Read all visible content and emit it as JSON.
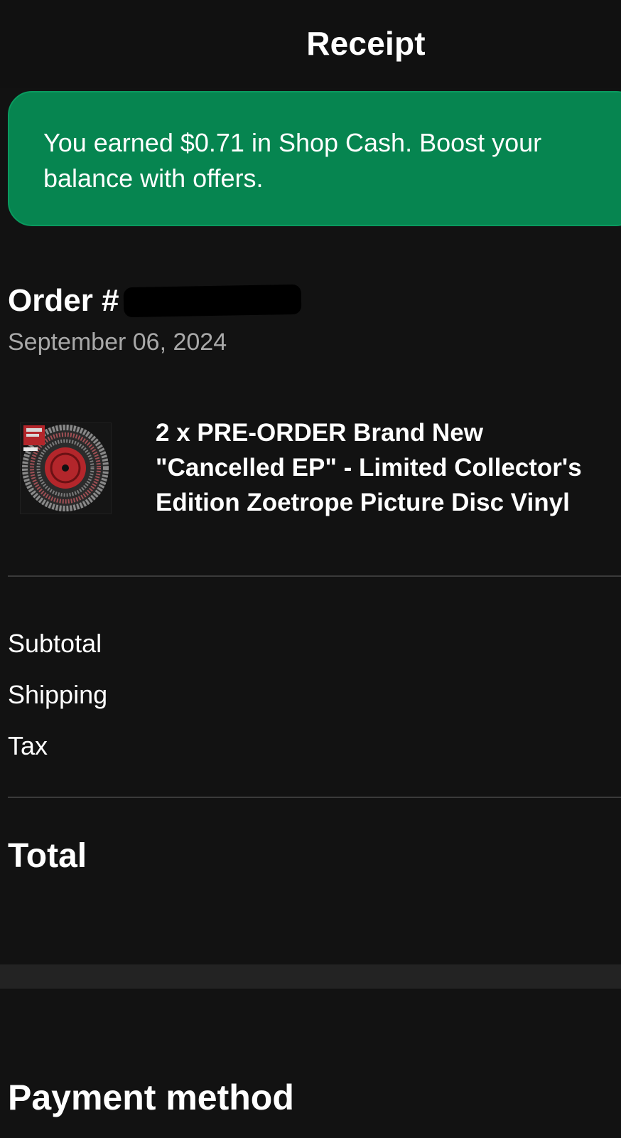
{
  "header": {
    "title": "Receipt"
  },
  "banner": {
    "text": "You earned $0.71 in Shop Cash. Boost your balance with offers."
  },
  "order": {
    "title_prefix": "Order #",
    "date": "September 06, 2024"
  },
  "product": {
    "title": "2 x PRE-ORDER Brand New \"Cancelled EP\" - Limited Collector's Edition Zoetrope Picture Disc Vinyl"
  },
  "summary": {
    "subtotal_label": "Subtotal",
    "shipping_label": "Shipping",
    "tax_label": "Tax",
    "total_label": "Total"
  },
  "payment": {
    "title": "Payment method"
  },
  "colors": {
    "background": "#121212",
    "banner_green": "#068550",
    "secondary_text": "#a9a9a9",
    "divider": "#3a3a3a",
    "vinyl_red": "#b3262b"
  },
  "icons": {
    "product_image": "zoetrope-picture-disc-vinyl-thumbnail"
  }
}
